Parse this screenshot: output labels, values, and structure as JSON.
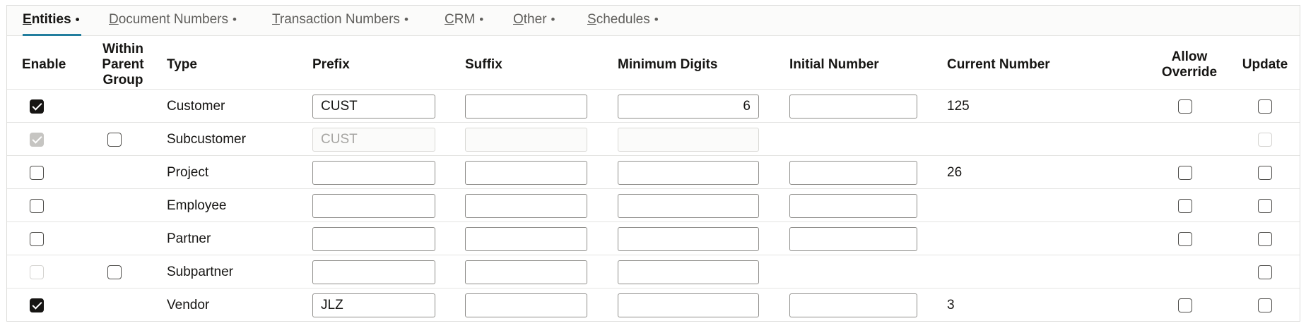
{
  "tabs": [
    {
      "key": "E",
      "rest": "ntities",
      "dot": "•",
      "active": true
    },
    {
      "key": "D",
      "rest": "ocument Numbers",
      "dot": "•",
      "active": false
    },
    {
      "key": "T",
      "rest": "ransaction Numbers",
      "dot": "•",
      "active": false
    },
    {
      "key": "C",
      "rest": "RM",
      "dot": "•",
      "active": false
    },
    {
      "key": "O",
      "rest": "ther",
      "dot": "•",
      "active": false
    },
    {
      "key": "S",
      "rest": "chedules",
      "dot": "•",
      "active": false
    }
  ],
  "columns": {
    "enable": "Enable",
    "within_parent_group": "Within Parent Group",
    "type": "Type",
    "prefix": "Prefix",
    "suffix": "Suffix",
    "minimum_digits": "Minimum Digits",
    "initial_number": "Initial Number",
    "current_number": "Current Number",
    "allow_override": "Allow Override",
    "update": "Update"
  },
  "rows": [
    {
      "type": "Customer",
      "enable": {
        "checked": true,
        "disabled": false
      },
      "within_parent_group": null,
      "prefix": {
        "value": "CUST",
        "disabled": false
      },
      "suffix": {
        "value": "",
        "disabled": false
      },
      "minimum_digits": {
        "value": "6",
        "disabled": false
      },
      "initial_number": {
        "value": ""
      },
      "current_number": "125",
      "allow_override": {
        "checked": false
      },
      "update": {
        "checked": false,
        "disabled": false
      }
    },
    {
      "type": "Subcustomer",
      "enable": {
        "checked": true,
        "disabled": true
      },
      "within_parent_group": {
        "checked": false
      },
      "prefix": {
        "value": "CUST",
        "disabled": true
      },
      "suffix": {
        "value": "",
        "disabled": true
      },
      "minimum_digits": {
        "value": "",
        "disabled": true
      },
      "initial_number": null,
      "current_number": "",
      "allow_override": null,
      "update": {
        "checked": false,
        "disabled": true
      }
    },
    {
      "type": "Project",
      "enable": {
        "checked": false,
        "disabled": false
      },
      "within_parent_group": null,
      "prefix": {
        "value": "",
        "disabled": false
      },
      "suffix": {
        "value": "",
        "disabled": false
      },
      "minimum_digits": {
        "value": "",
        "disabled": false
      },
      "initial_number": {
        "value": ""
      },
      "current_number": "26",
      "allow_override": {
        "checked": false
      },
      "update": {
        "checked": false,
        "disabled": false
      }
    },
    {
      "type": "Employee",
      "enable": {
        "checked": false,
        "disabled": false
      },
      "within_parent_group": null,
      "prefix": {
        "value": "",
        "disabled": false
      },
      "suffix": {
        "value": "",
        "disabled": false
      },
      "minimum_digits": {
        "value": "",
        "disabled": false
      },
      "initial_number": {
        "value": ""
      },
      "current_number": "",
      "allow_override": {
        "checked": false
      },
      "update": {
        "checked": false,
        "disabled": false
      }
    },
    {
      "type": "Partner",
      "enable": {
        "checked": false,
        "disabled": false
      },
      "within_parent_group": null,
      "prefix": {
        "value": "",
        "disabled": false
      },
      "suffix": {
        "value": "",
        "disabled": false
      },
      "minimum_digits": {
        "value": "",
        "disabled": false
      },
      "initial_number": {
        "value": ""
      },
      "current_number": "",
      "allow_override": {
        "checked": false
      },
      "update": {
        "checked": false,
        "disabled": false
      }
    },
    {
      "type": "Subpartner",
      "enable": {
        "checked": false,
        "disabled": true
      },
      "within_parent_group": {
        "checked": false
      },
      "prefix": {
        "value": "",
        "disabled": false
      },
      "suffix": {
        "value": "",
        "disabled": false
      },
      "minimum_digits": {
        "value": "",
        "disabled": false
      },
      "initial_number": null,
      "current_number": "",
      "allow_override": null,
      "update": {
        "checked": false,
        "disabled": false
      }
    },
    {
      "type": "Vendor",
      "enable": {
        "checked": true,
        "disabled": false
      },
      "within_parent_group": null,
      "prefix": {
        "value": "JLZ",
        "disabled": false
      },
      "suffix": {
        "value": "",
        "disabled": false
      },
      "minimum_digits": {
        "value": "",
        "disabled": false
      },
      "initial_number": {
        "value": ""
      },
      "current_number": "3",
      "allow_override": {
        "checked": false
      },
      "update": {
        "checked": false,
        "disabled": false
      }
    }
  ]
}
